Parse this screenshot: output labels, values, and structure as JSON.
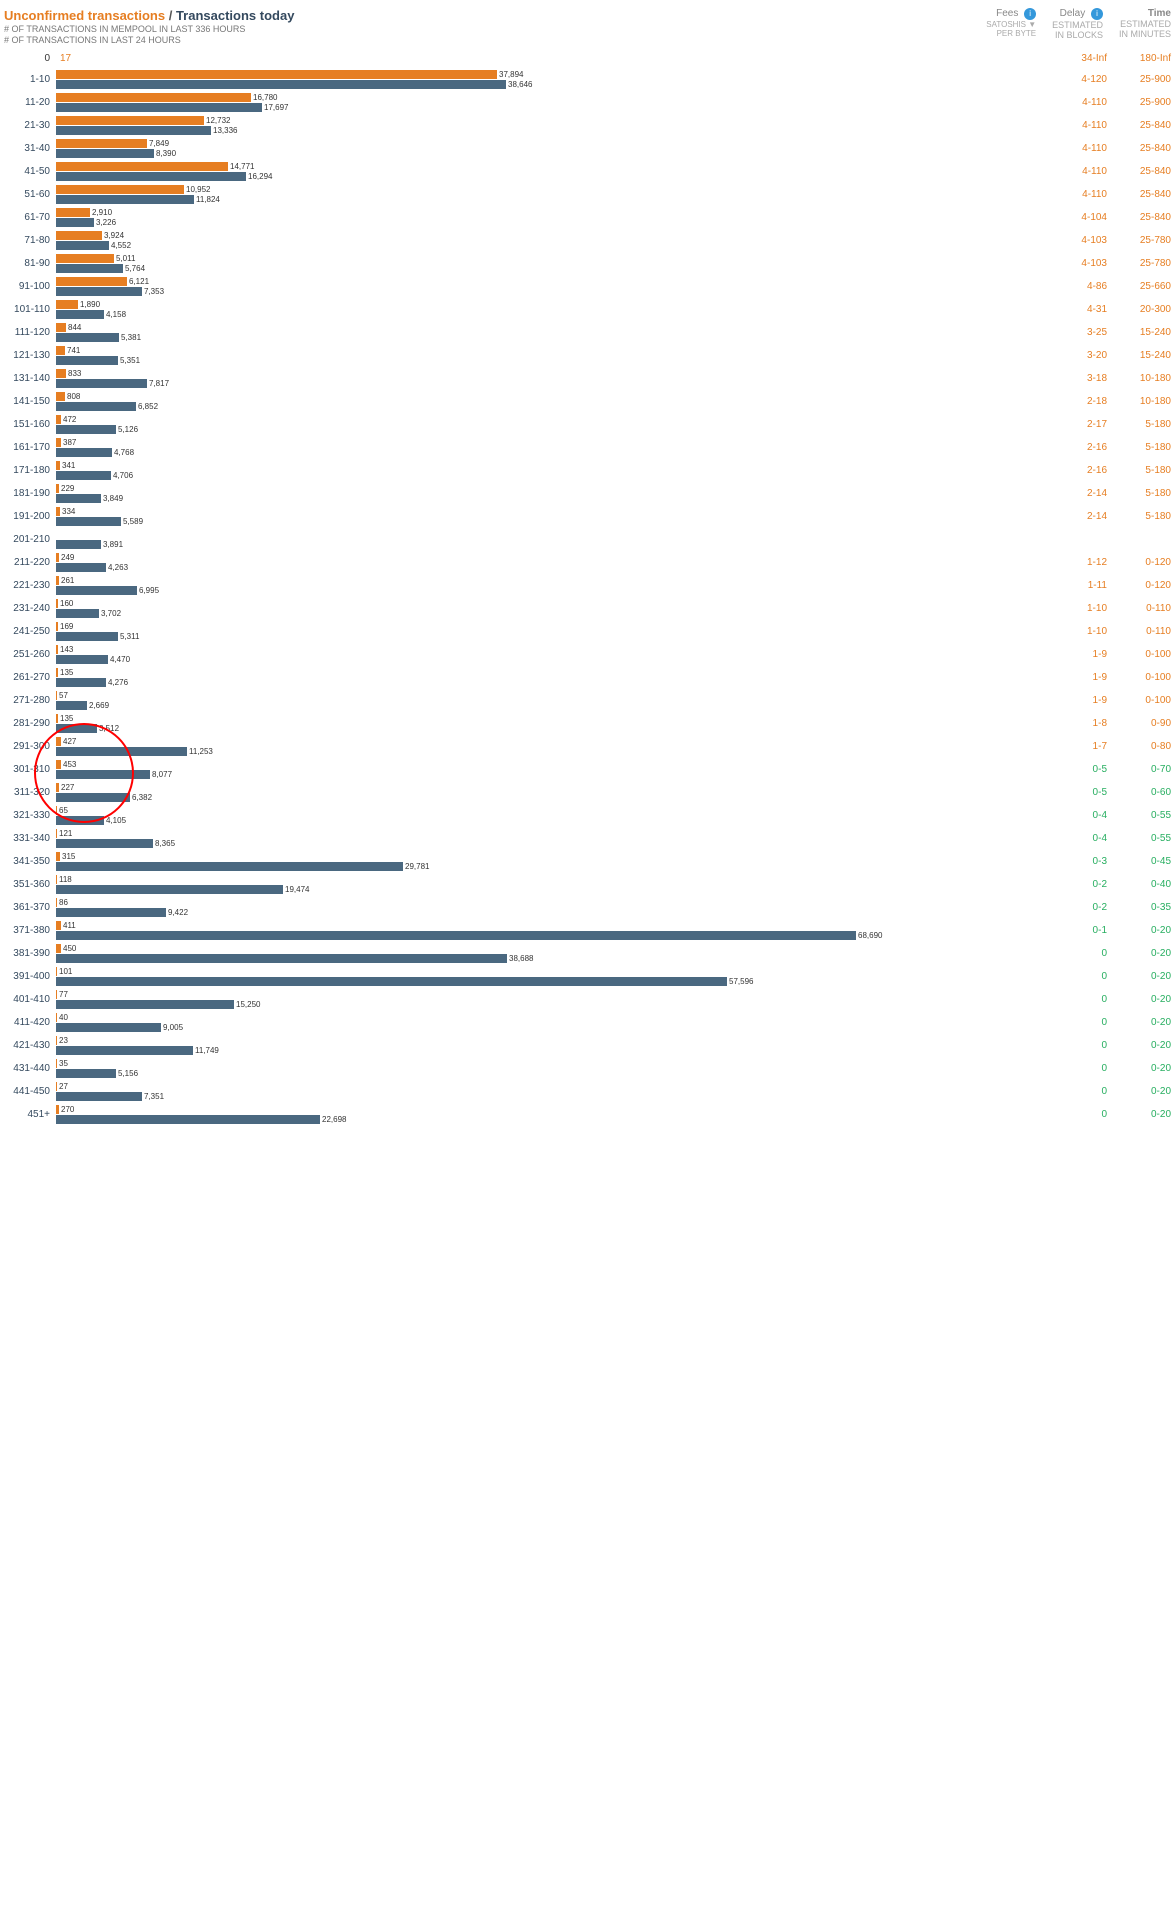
{
  "header": {
    "title_unconfirmed": "Unconfirmed transactions",
    "title_separator": " / ",
    "title_today": "Transactions today",
    "subtitle1": "# OF TRANSACTIONS IN MEMPOOL IN LAST 336 HOURS",
    "subtitle2": "# OF TRANSACTIONS IN LAST 24 HOURS",
    "fees_label": "Fees",
    "fees_sub": "SATOSHIS ▼\nPER BYTE",
    "delay_label": "Delay",
    "delay_sub": "ESTIMATED\nIN BLOCKS",
    "time_label": "Time",
    "time_sub": "ESTIMATED\nIN MINUTES"
  },
  "top_row": {
    "zero_label": "0",
    "seventeen": "17",
    "inf_delay": "34-Inf",
    "inf_time": "180-Inf"
  },
  "rows": [
    {
      "fee": "1-10",
      "orange": 37894,
      "blue": 38646,
      "orange_w": 620,
      "blue_w": 632,
      "delay": "4-120",
      "time": "25-900",
      "delay_color": "orange"
    },
    {
      "fee": "11-20",
      "orange": 16780,
      "blue": 17697,
      "orange_w": 275,
      "blue_w": 290,
      "delay": "4-110",
      "time": "25-900",
      "delay_color": "orange"
    },
    {
      "fee": "21-30",
      "orange": 12732,
      "blue": 13336,
      "orange_w": 208,
      "blue_w": 218,
      "delay": "4-110",
      "time": "25-840",
      "delay_color": "orange"
    },
    {
      "fee": "31-40",
      "orange": 7849,
      "blue": 8390,
      "orange_w": 128,
      "blue_w": 137,
      "delay": "4-110",
      "time": "25-840",
      "delay_color": "orange"
    },
    {
      "fee": "41-50",
      "orange": 14771,
      "blue": 16294,
      "orange_w": 242,
      "blue_w": 266,
      "delay": "4-110",
      "time": "25-840",
      "delay_color": "orange"
    },
    {
      "fee": "51-60",
      "orange": 10952,
      "blue": 11824,
      "orange_w": 179,
      "blue_w": 193,
      "delay": "4-110",
      "time": "25-840",
      "delay_color": "orange"
    },
    {
      "fee": "61-70",
      "orange": 2910,
      "blue": 3226,
      "orange_w": 47,
      "blue_w": 53,
      "delay": "4-104",
      "time": "25-840",
      "delay_color": "orange"
    },
    {
      "fee": "71-80",
      "orange": 3924,
      "blue": 4552,
      "orange_w": 64,
      "blue_w": 74,
      "delay": "4-103",
      "time": "25-780",
      "delay_color": "orange"
    },
    {
      "fee": "81-90",
      "orange": 5011,
      "blue": 5764,
      "orange_w": 82,
      "blue_w": 94,
      "delay": "4-103",
      "time": "25-780",
      "delay_color": "orange"
    },
    {
      "fee": "91-100",
      "orange": 6121,
      "blue": 7353,
      "orange_w": 100,
      "blue_w": 120,
      "delay": "4-86",
      "time": "25-660",
      "delay_color": "orange"
    },
    {
      "fee": "101-110",
      "orange": 1890,
      "blue": 4158,
      "orange_w": 31,
      "blue_w": 68,
      "delay": "4-31",
      "time": "20-300",
      "delay_color": "orange"
    },
    {
      "fee": "111-120",
      "orange": 844,
      "blue": 5381,
      "orange_w": 14,
      "blue_w": 88,
      "delay": "3-25",
      "time": "15-240",
      "delay_color": "orange"
    },
    {
      "fee": "121-130",
      "orange": 741,
      "blue": 5351,
      "orange_w": 12,
      "blue_w": 87,
      "delay": "3-20",
      "time": "15-240",
      "delay_color": "orange"
    },
    {
      "fee": "131-140",
      "orange": 833,
      "blue": 7817,
      "orange_w": 14,
      "blue_w": 128,
      "delay": "3-18",
      "time": "10-180",
      "delay_color": "orange"
    },
    {
      "fee": "141-150",
      "orange": 808,
      "blue": 6852,
      "orange_w": 13,
      "blue_w": 112,
      "delay": "2-18",
      "time": "10-180",
      "delay_color": "orange"
    },
    {
      "fee": "151-160",
      "orange": 472,
      "blue": 5126,
      "orange_w": 8,
      "blue_w": 84,
      "delay": "2-17",
      "time": "5-180",
      "delay_color": "orange"
    },
    {
      "fee": "161-170",
      "orange": 387,
      "blue": 4768,
      "orange_w": 6,
      "blue_w": 78,
      "delay": "2-16",
      "time": "5-180",
      "delay_color": "orange"
    },
    {
      "fee": "171-180",
      "orange": 341,
      "blue": 4706,
      "orange_w": 6,
      "blue_w": 77,
      "delay": "2-16",
      "time": "5-180",
      "delay_color": "orange"
    },
    {
      "fee": "181-190",
      "orange": 229,
      "blue": 3849,
      "orange_w": 4,
      "blue_w": 63,
      "delay": "2-14",
      "time": "5-180",
      "delay_color": "orange"
    },
    {
      "fee": "191-200",
      "orange": 334,
      "blue": 5589,
      "orange_w": 5,
      "blue_w": 91,
      "delay": "2-14",
      "time": "5-180",
      "delay_color": "orange"
    },
    {
      "fee": "201-210",
      "orange": 0,
      "blue": 3891,
      "orange_w": 0,
      "blue_w": 64,
      "delay": "",
      "time": "",
      "delay_color": "gray"
    },
    {
      "fee": "211-220",
      "orange": 249,
      "blue": 4263,
      "orange_w": 4,
      "blue_w": 70,
      "delay": "1-12",
      "time": "0-120",
      "delay_color": "orange"
    },
    {
      "fee": "221-230",
      "orange": 261,
      "blue": 6995,
      "orange_w": 4,
      "blue_w": 114,
      "delay": "1-11",
      "time": "0-120",
      "delay_color": "orange"
    },
    {
      "fee": "231-240",
      "orange": 160,
      "blue": 3702,
      "orange_w": 3,
      "blue_w": 61,
      "delay": "1-10",
      "time": "0-110",
      "delay_color": "orange"
    },
    {
      "fee": "241-250",
      "orange": 169,
      "blue": 5311,
      "orange_w": 3,
      "blue_w": 87,
      "delay": "1-10",
      "time": "0-110",
      "delay_color": "orange"
    },
    {
      "fee": "251-260",
      "orange": 143,
      "blue": 4470,
      "orange_w": 2,
      "blue_w": 73,
      "delay": "1-9",
      "time": "0-100",
      "delay_color": "orange"
    },
    {
      "fee": "261-270",
      "orange": 135,
      "blue": 4276,
      "orange_w": 2,
      "blue_w": 70,
      "delay": "1-9",
      "time": "0-100",
      "delay_color": "orange"
    },
    {
      "fee": "271-280",
      "orange": 57,
      "blue": 2669,
      "orange_w": 1,
      "blue_w": 44,
      "delay": "1-9",
      "time": "0-100",
      "delay_color": "orange"
    },
    {
      "fee": "281-290",
      "orange": 135,
      "blue": 3512,
      "orange_w": 2,
      "blue_w": 57,
      "delay": "1-8",
      "time": "0-90",
      "delay_color": "orange"
    },
    {
      "fee": "291-300",
      "orange": 427,
      "blue": 11253,
      "orange_w": 7,
      "blue_w": 184,
      "delay": "1-7",
      "time": "0-80",
      "delay_color": "orange"
    },
    {
      "fee": "301-310",
      "orange": 453,
      "blue": 8077,
      "orange_w": 7,
      "blue_w": 132,
      "delay": "0-5",
      "time": "0-70",
      "delay_color": "green"
    },
    {
      "fee": "311-320",
      "orange": 227,
      "blue": 6382,
      "orange_w": 4,
      "blue_w": 104,
      "delay": "0-5",
      "time": "0-60",
      "delay_color": "green"
    },
    {
      "fee": "321-330",
      "orange": 65,
      "blue": 4105,
      "orange_w": 1,
      "blue_w": 67,
      "delay": "0-4",
      "time": "0-55",
      "delay_color": "green"
    },
    {
      "fee": "331-340",
      "orange": 121,
      "blue": 8365,
      "orange_w": 2,
      "blue_w": 137,
      "delay": "0-4",
      "time": "0-55",
      "delay_color": "green"
    },
    {
      "fee": "341-350",
      "orange": 315,
      "blue": 29781,
      "orange_w": 5,
      "blue_w": 487,
      "delay": "0-3",
      "time": "0-45",
      "delay_color": "green"
    },
    {
      "fee": "351-360",
      "orange": 118,
      "blue": 19474,
      "orange_w": 2,
      "blue_w": 318,
      "delay": "0-2",
      "time": "0-40",
      "delay_color": "green"
    },
    {
      "fee": "361-370",
      "orange": 86,
      "blue": 9422,
      "orange_w": 1,
      "blue_w": 154,
      "delay": "0-2",
      "time": "0-35",
      "delay_color": "green"
    },
    {
      "fee": "371-380",
      "orange": 411,
      "blue": 68690,
      "orange_w": 7,
      "blue_w": 800,
      "delay": "0-1",
      "time": "0-20",
      "delay_color": "green"
    },
    {
      "fee": "381-390",
      "orange": 450,
      "blue": 38688,
      "orange_w": 7,
      "blue_w": 633,
      "delay": "0",
      "time": "0-20",
      "delay_color": "green"
    },
    {
      "fee": "391-400",
      "orange": 101,
      "blue": 57596,
      "orange_w": 2,
      "blue_w": 800,
      "delay": "0",
      "time": "0-20",
      "delay_color": "green"
    },
    {
      "fee": "401-410",
      "orange": 77,
      "blue": 15250,
      "orange_w": 1,
      "blue_w": 249,
      "delay": "0",
      "time": "0-20",
      "delay_color": "green"
    },
    {
      "fee": "411-420",
      "orange": 40,
      "blue": 9005,
      "orange_w": 1,
      "blue_w": 147,
      "delay": "0",
      "time": "0-20",
      "delay_color": "green"
    },
    {
      "fee": "421-430",
      "orange": 23,
      "blue": 11749,
      "orange_w": 0,
      "blue_w": 192,
      "delay": "0",
      "time": "0-20",
      "delay_color": "green"
    },
    {
      "fee": "431-440",
      "orange": 35,
      "blue": 5156,
      "orange_w": 1,
      "blue_w": 84,
      "delay": "0",
      "time": "0-20",
      "delay_color": "green"
    },
    {
      "fee": "441-450",
      "orange": 27,
      "blue": 7351,
      "orange_w": 0,
      "blue_w": 120,
      "delay": "0",
      "time": "0-20",
      "delay_color": "green"
    },
    {
      "fee": "451+",
      "orange": 270,
      "blue": 22698,
      "orange_w": 4,
      "blue_w": 371,
      "delay": "0",
      "time": "0-20",
      "delay_color": "green"
    }
  ]
}
